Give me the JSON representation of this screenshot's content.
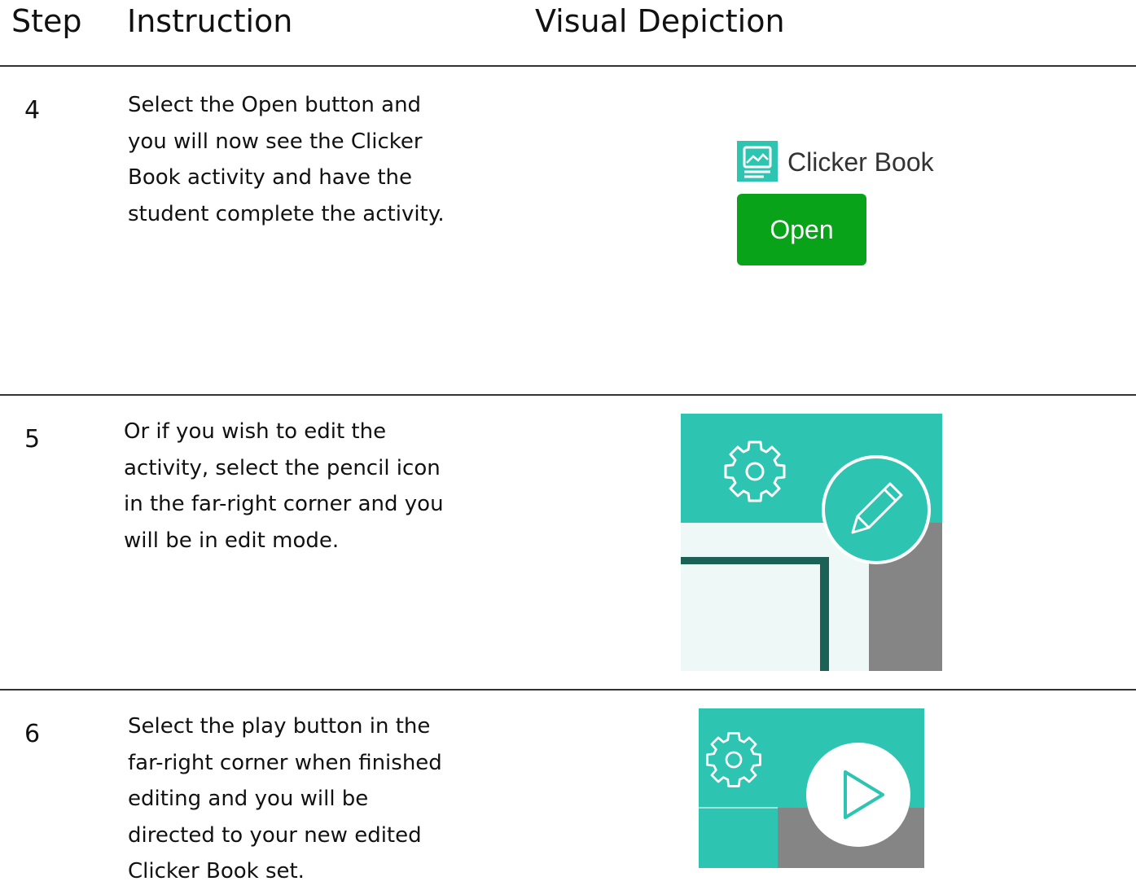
{
  "headers": {
    "step": "Step",
    "instruction": "Instruction",
    "visual": "Visual Depiction"
  },
  "rows": [
    {
      "step": "4",
      "lines": [
        "Select the Open button and",
        "you will now see the Clicker",
        "Book activity and have the",
        "student complete the activity."
      ],
      "visual": {
        "title": "Clicker Book",
        "button_label": "Open",
        "icon": "image-book-icon"
      }
    },
    {
      "step": "5",
      "lines": [
        "Or if you wish to edit the",
        "activity, select the pencil icon",
        "in the far-right corner and you",
        "will be in edit mode."
      ],
      "visual": {
        "icons": [
          "gear-icon",
          "pencil-icon"
        ]
      }
    },
    {
      "step": "6",
      "lines": [
        "Select the play button in the",
        "far-right corner when finished",
        "editing and you will be",
        "directed to your new edited",
        "Clicker Book set."
      ],
      "visual": {
        "icons": [
          "gear-icon",
          "play-icon"
        ]
      }
    }
  ],
  "colors": {
    "teal": "#2ec4b2",
    "open_green": "#09a31a",
    "dark_teal": "#1b6156",
    "gray": "#858585",
    "pale": "#eef8f7"
  }
}
